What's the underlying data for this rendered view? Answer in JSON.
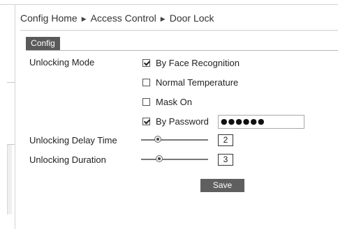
{
  "breadcrumb": {
    "items": [
      "Config Home",
      "Access Control",
      "Door Lock"
    ],
    "separator": "▶"
  },
  "tabs": {
    "active": "Config"
  },
  "form": {
    "unlocking_mode_label": "Unlocking Mode",
    "options": {
      "face": {
        "label": "By Face Recognition",
        "checked": true
      },
      "temperature": {
        "label": "Normal Temperature",
        "checked": false
      },
      "mask": {
        "label": "Mask On",
        "checked": false
      },
      "password": {
        "label": "By Password",
        "checked": true,
        "value": "●●●●●●"
      }
    },
    "delay": {
      "label": "Unlocking Delay Time",
      "value": "2"
    },
    "duration": {
      "label": "Unlocking Duration",
      "value": "3"
    }
  },
  "save_label": "Save",
  "colors": {
    "tab_bg": "#5a5a5a",
    "button_bg": "#5f5f5f"
  }
}
